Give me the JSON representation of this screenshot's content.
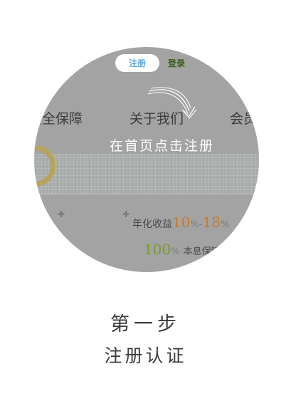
{
  "screenshot": {
    "tabs": {
      "register_label": "注册",
      "login_label": "登录"
    },
    "nav": {
      "items": [
        "安全保障",
        "关于我们",
        "会员"
      ]
    },
    "instruction": "在首页点击注册",
    "yield": {
      "label": "年化收益",
      "min_value": "10",
      "min_unit": "%",
      "separator": "-",
      "max_value": "18",
      "max_unit": "%"
    },
    "guarantee": {
      "value": "100",
      "unit": "%",
      "label": "本息保障"
    }
  },
  "step": {
    "title": "第一步",
    "subtitle": "注册认证"
  },
  "colors": {
    "overlay_gray": "#a3a3a3",
    "register_tab_text": "#5aa7d6",
    "login_tab_text": "#3d5e22",
    "yield_orange": "#c8792a",
    "guarantee_green": "#7a9a2a"
  }
}
